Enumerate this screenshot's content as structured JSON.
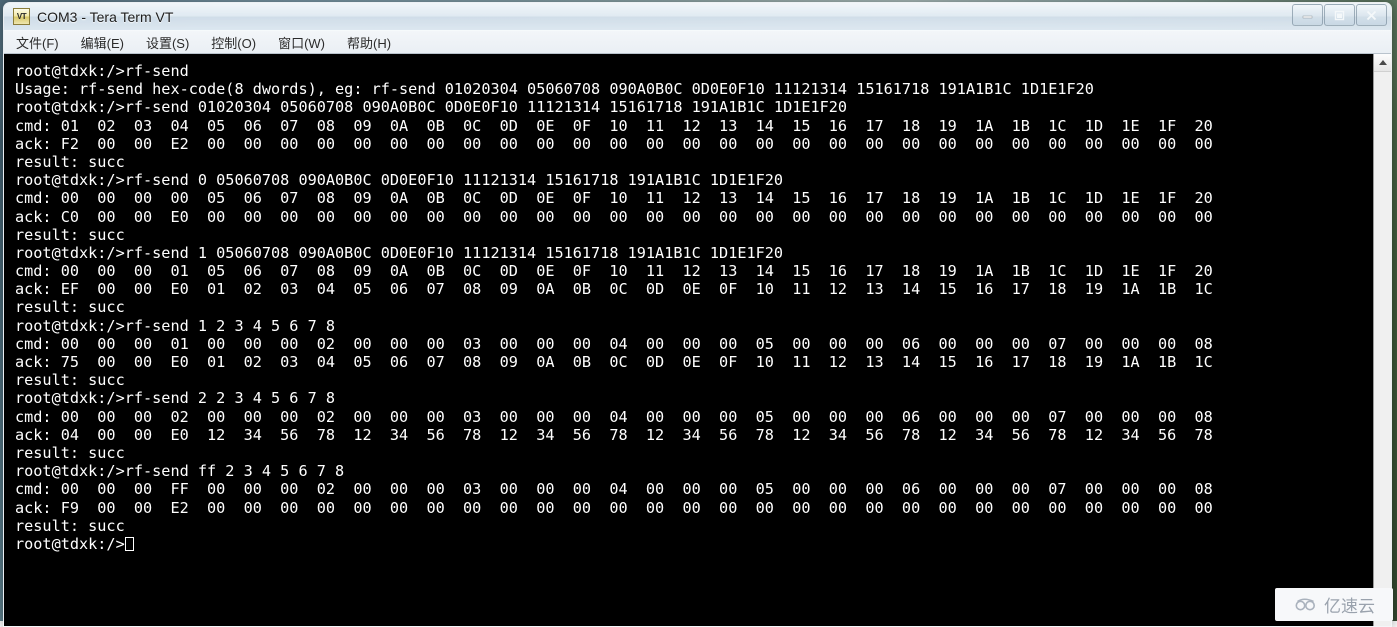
{
  "window": {
    "title": "COM3 - Tera Term VT",
    "icon_label": "VT",
    "buttons": {
      "minimize": "minimize-button",
      "maximize": "maximize-button",
      "close": "close-button"
    }
  },
  "menubar": {
    "items": [
      {
        "label": "文件(F)",
        "name": "menu-file"
      },
      {
        "label": "编辑(E)",
        "name": "menu-edit"
      },
      {
        "label": "设置(S)",
        "name": "menu-setup"
      },
      {
        "label": "控制(O)",
        "name": "menu-control"
      },
      {
        "label": "窗口(W)",
        "name": "menu-window"
      },
      {
        "label": "帮助(H)",
        "name": "menu-help"
      }
    ]
  },
  "terminal": {
    "prompt": "root@tdxk:/>",
    "cursor_visible": true,
    "lines": [
      "root@tdxk:/>rf-send",
      "Usage: rf-send hex-code(8 dwords), eg: rf-send 01020304 05060708 090A0B0C 0D0E0F10 11121314 15161718 191A1B1C 1D1E1F20",
      "root@tdxk:/>rf-send 01020304 05060708 090A0B0C 0D0E0F10 11121314 15161718 191A1B1C 1D1E1F20",
      "cmd: 01  02  03  04  05  06  07  08  09  0A  0B  0C  0D  0E  0F  10  11  12  13  14  15  16  17  18  19  1A  1B  1C  1D  1E  1F  20",
      "ack: F2  00  00  E2  00  00  00  00  00  00  00  00  00  00  00  00  00  00  00  00  00  00  00  00  00  00  00  00  00  00  00  00",
      "result: succ",
      "root@tdxk:/>rf-send 0 05060708 090A0B0C 0D0E0F10 11121314 15161718 191A1B1C 1D1E1F20",
      "cmd: 00  00  00  00  05  06  07  08  09  0A  0B  0C  0D  0E  0F  10  11  12  13  14  15  16  17  18  19  1A  1B  1C  1D  1E  1F  20",
      "ack: C0  00  00  E0  00  00  00  00  00  00  00  00  00  00  00  00  00  00  00  00  00  00  00  00  00  00  00  00  00  00  00  00",
      "result: succ",
      "root@tdxk:/>rf-send 1 05060708 090A0B0C 0D0E0F10 11121314 15161718 191A1B1C 1D1E1F20",
      "cmd: 00  00  00  01  05  06  07  08  09  0A  0B  0C  0D  0E  0F  10  11  12  13  14  15  16  17  18  19  1A  1B  1C  1D  1E  1F  20",
      "ack: EF  00  00  E0  01  02  03  04  05  06  07  08  09  0A  0B  0C  0D  0E  0F  10  11  12  13  14  15  16  17  18  19  1A  1B  1C",
      "result: succ",
      "root@tdxk:/>rf-send 1 2 3 4 5 6 7 8",
      "cmd: 00  00  00  01  00  00  00  02  00  00  00  03  00  00  00  04  00  00  00  05  00  00  00  06  00  00  00  07  00  00  00  08",
      "ack: 75  00  00  E0  01  02  03  04  05  06  07  08  09  0A  0B  0C  0D  0E  0F  10  11  12  13  14  15  16  17  18  19  1A  1B  1C",
      "result: succ",
      "root@tdxk:/>rf-send 2 2 3 4 5 6 7 8",
      "cmd: 00  00  00  02  00  00  00  02  00  00  00  03  00  00  00  04  00  00  00  05  00  00  00  06  00  00  00  07  00  00  00  08",
      "ack: 04  00  00  E0  12  34  56  78  12  34  56  78  12  34  56  78  12  34  56  78  12  34  56  78  12  34  56  78  12  34  56  78",
      "result: succ",
      "root@tdxk:/>rf-send ff 2 3 4 5 6 7 8",
      "cmd: 00  00  00  FF  00  00  00  02  00  00  00  03  00  00  00  04  00  00  00  05  00  00  00  06  00  00  00  07  00  00  00  08",
      "ack: F9  00  00  E2  00  00  00  00  00  00  00  00  00  00  00  00  00  00  00  00  00  00  00  00  00  00  00  00  00  00  00  00",
      "result: succ"
    ],
    "last_line_prompt": "root@tdxk:/>"
  },
  "scrollbar": {
    "up_arrow": "scroll-up-arrow"
  },
  "watermark": {
    "text": "亿速云"
  },
  "colors": {
    "terminal_bg": "#000000",
    "terminal_fg": "#ffffff",
    "titlebar": "#e2e9f0",
    "menubar": "#eef2f6"
  }
}
